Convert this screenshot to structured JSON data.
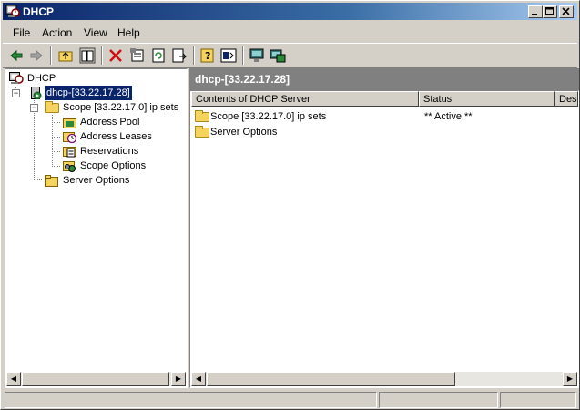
{
  "window": {
    "title": "DHCP"
  },
  "menu": [
    {
      "label": "File"
    },
    {
      "label": "Action"
    },
    {
      "label": "View"
    },
    {
      "label": "Help"
    }
  ],
  "toolbar": {
    "buttons": [
      "back-icon",
      "forward-icon",
      "up-folder-icon",
      "show-tree-icon",
      "delete-icon",
      "properties-icon",
      "refresh-icon",
      "export-list-icon",
      "help-icon",
      "action-pane-icon",
      "server-icon",
      "server-add-icon"
    ]
  },
  "tree": {
    "root": "DHCP",
    "server": "dhcp-[33.22.17.28]",
    "scope": "Scope [33.22.17.0] ip sets",
    "scope_children": [
      "Address Pool",
      "Address Leases",
      "Reservations",
      "Scope Options"
    ],
    "server_options": "Server Options"
  },
  "right": {
    "header": "dhcp-[33.22.17.28]",
    "columns": [
      "Contents of DHCP Server",
      "Status",
      "Description"
    ],
    "rows": [
      {
        "name": "Scope [33.22.17.0] ip sets",
        "status": "** Active **"
      },
      {
        "name": "Server Options",
        "status": ""
      }
    ]
  },
  "colors": {
    "titlebar": "#0a246a",
    "selection": "#0a246a",
    "panel_header": "#808080"
  }
}
